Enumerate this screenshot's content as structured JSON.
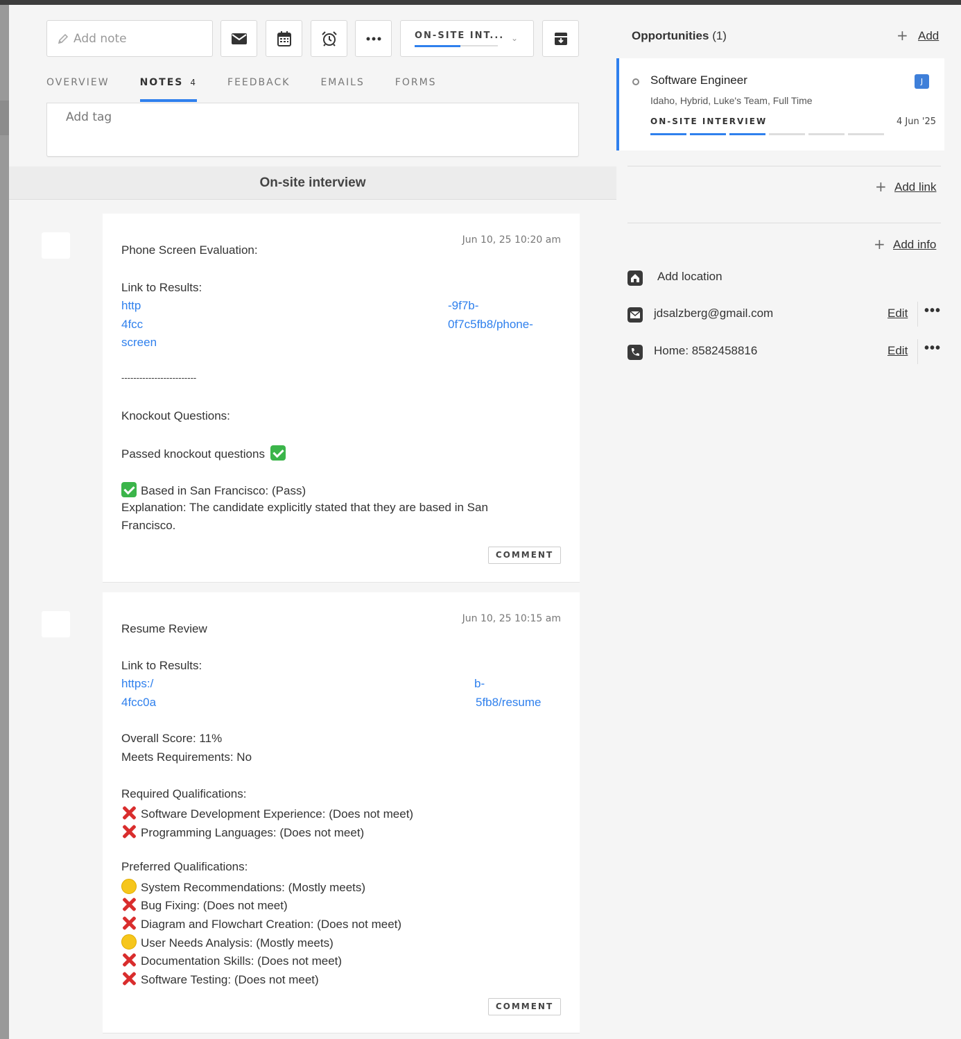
{
  "toolbar": {
    "note_placeholder": "Add note",
    "stage_label": "ON-SITE INT...",
    "stage_progress": 0.55
  },
  "tabs": [
    {
      "label": "OVERVIEW"
    },
    {
      "label": "NOTES",
      "count": "4"
    },
    {
      "label": "FEEDBACK"
    },
    {
      "label": "EMAILS"
    },
    {
      "label": "FORMS"
    }
  ],
  "tag_placeholder": "Add tag",
  "section_title": "On-site interview",
  "notes": [
    {
      "timestamp": "Jun 10, 25 10:20 am",
      "title": "Phone Screen Evaluation:",
      "link_label": "Link to Results:",
      "link_lines": [
        "http",
        "4fcc",
        "screen"
      ],
      "link_lines_right": [
        "-9f7b-",
        "0f7c5fb8/phone-"
      ],
      "separator": "-------------------------",
      "knockout_title": "Knockout Questions:",
      "passed": "Passed knockout questions",
      "based": "Based in San Francisco: (Pass)",
      "explanation_1": "Explanation: The candidate explicitly stated that they are based in San",
      "explanation_2": "Francisco.",
      "comment": "COMMENT"
    },
    {
      "timestamp": "Jun 10, 25 10:15 am",
      "title": "Resume Review",
      "link_label": "Link to Results:",
      "link_lines": [
        "https:/",
        "4fcc0a"
      ],
      "link_lines_right": [
        "b-",
        "5fb8/resume"
      ],
      "overall_score": "Overall Score: 11%",
      "meets": "Meets Requirements: No",
      "required_title": "Required Qualifications:",
      "required": [
        {
          "icon": "x",
          "text": "Software Development Experience: (Does not meet)"
        },
        {
          "icon": "x",
          "text": "Programming Languages: (Does not meet)"
        }
      ],
      "preferred_title": "Preferred Qualifications:",
      "preferred": [
        {
          "icon": "circle",
          "text": "System Recommendations: (Mostly meets)"
        },
        {
          "icon": "x",
          "text": "Bug Fixing: (Does not meet)"
        },
        {
          "icon": "x",
          "text": "Diagram and Flowchart Creation: (Does not meet)"
        },
        {
          "icon": "circle",
          "text": "User Needs Analysis: (Mostly meets)"
        },
        {
          "icon": "x",
          "text": "Documentation Skills: (Does not meet)"
        },
        {
          "icon": "x",
          "text": "Software Testing: (Does not meet)"
        }
      ],
      "comment": "COMMENT"
    }
  ],
  "sidebar": {
    "opportunities_label": "Opportunities",
    "opportunities_count": "(1)",
    "add_label": "Add",
    "opportunity": {
      "title": "Software Engineer",
      "subtitle": "Idaho, Hybrid, Luke's Team, Full Time",
      "stage": "ON-SITE INTERVIEW",
      "date": "4 Jun '25",
      "badge": "J",
      "stages_done": 3,
      "stages_total": 6
    },
    "add_link_label": "Add link",
    "add_info_label": "Add info",
    "location_placeholder": "Add location",
    "email": "jdsalzberg@gmail.com",
    "phone": "Home: 8582458816",
    "edit_label": "Edit"
  },
  "colors": {
    "accent": "#2f80ed",
    "pass": "#3bb54a",
    "fail": "#d92d2d",
    "partial": "#f6c61c"
  }
}
